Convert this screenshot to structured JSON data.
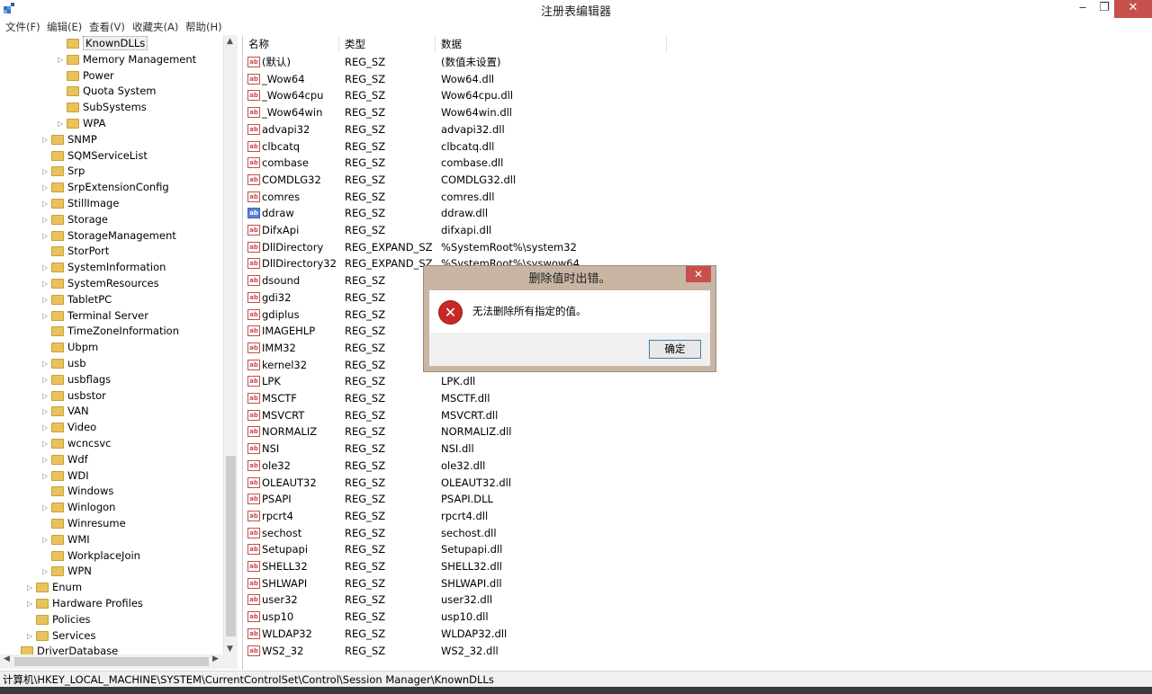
{
  "window": {
    "title": "注册表编辑器",
    "minimize": "‒",
    "restore": "❐",
    "close": "✕"
  },
  "menu": [
    "文件(F)",
    "编辑(E)",
    "查看(V)",
    "收藏夹(A)",
    "帮助(H)"
  ],
  "tree": {
    "items": [
      {
        "label": "KnownDLLs",
        "level": 2,
        "expander": "",
        "selected": true
      },
      {
        "label": "Memory Management",
        "level": 2,
        "expander": "▷"
      },
      {
        "label": "Power",
        "level": 2,
        "expander": ""
      },
      {
        "label": "Quota System",
        "level": 2,
        "expander": ""
      },
      {
        "label": "SubSystems",
        "level": 2,
        "expander": ""
      },
      {
        "label": "WPA",
        "level": 2,
        "expander": "▷"
      },
      {
        "label": "SNMP",
        "level": 1,
        "expander": "▷"
      },
      {
        "label": "SQMServiceList",
        "level": 1,
        "expander": ""
      },
      {
        "label": "Srp",
        "level": 1,
        "expander": "▷"
      },
      {
        "label": "SrpExtensionConfig",
        "level": 1,
        "expander": "▷"
      },
      {
        "label": "StillImage",
        "level": 1,
        "expander": "▷"
      },
      {
        "label": "Storage",
        "level": 1,
        "expander": "▷"
      },
      {
        "label": "StorageManagement",
        "level": 1,
        "expander": "▷"
      },
      {
        "label": "StorPort",
        "level": 1,
        "expander": ""
      },
      {
        "label": "SystemInformation",
        "level": 1,
        "expander": "▷"
      },
      {
        "label": "SystemResources",
        "level": 1,
        "expander": "▷"
      },
      {
        "label": "TabletPC",
        "level": 1,
        "expander": "▷"
      },
      {
        "label": "Terminal Server",
        "level": 1,
        "expander": "▷"
      },
      {
        "label": "TimeZoneInformation",
        "level": 1,
        "expander": ""
      },
      {
        "label": "Ubpm",
        "level": 1,
        "expander": ""
      },
      {
        "label": "usb",
        "level": 1,
        "expander": "▷"
      },
      {
        "label": "usbflags",
        "level": 1,
        "expander": "▷"
      },
      {
        "label": "usbstor",
        "level": 1,
        "expander": "▷"
      },
      {
        "label": "VAN",
        "level": 1,
        "expander": "▷"
      },
      {
        "label": "Video",
        "level": 1,
        "expander": "▷"
      },
      {
        "label": "wcncsvc",
        "level": 1,
        "expander": "▷"
      },
      {
        "label": "Wdf",
        "level": 1,
        "expander": "▷"
      },
      {
        "label": "WDI",
        "level": 1,
        "expander": "▷"
      },
      {
        "label": "Windows",
        "level": 1,
        "expander": ""
      },
      {
        "label": "Winlogon",
        "level": 1,
        "expander": "▷"
      },
      {
        "label": "Winresume",
        "level": 1,
        "expander": ""
      },
      {
        "label": "WMI",
        "level": 1,
        "expander": "▷"
      },
      {
        "label": "WorkplaceJoin",
        "level": 1,
        "expander": ""
      },
      {
        "label": "WPN",
        "level": 1,
        "expander": "▷"
      },
      {
        "label": "Enum",
        "level": 0,
        "expander": "▷"
      },
      {
        "label": "Hardware Profiles",
        "level": 0,
        "expander": "▷"
      },
      {
        "label": "Policies",
        "level": 0,
        "expander": ""
      },
      {
        "label": "Services",
        "level": 0,
        "expander": "▷"
      },
      {
        "label": "DriverDatabase",
        "level": -1,
        "expander": ""
      }
    ]
  },
  "list": {
    "headers": {
      "name": "名称",
      "type": "类型",
      "data": "数据"
    },
    "icon_text": "ab",
    "rows": [
      {
        "name": "(默认)",
        "type": "REG_SZ",
        "data": "(数值未设置)"
      },
      {
        "name": "_Wow64",
        "type": "REG_SZ",
        "data": "Wow64.dll"
      },
      {
        "name": "_Wow64cpu",
        "type": "REG_SZ",
        "data": "Wow64cpu.dll"
      },
      {
        "name": "_Wow64win",
        "type": "REG_SZ",
        "data": "Wow64win.dll"
      },
      {
        "name": "advapi32",
        "type": "REG_SZ",
        "data": "advapi32.dll"
      },
      {
        "name": "clbcatq",
        "type": "REG_SZ",
        "data": "clbcatq.dll"
      },
      {
        "name": "combase",
        "type": "REG_SZ",
        "data": "combase.dll"
      },
      {
        "name": "COMDLG32",
        "type": "REG_SZ",
        "data": "COMDLG32.dll"
      },
      {
        "name": "comres",
        "type": "REG_SZ",
        "data": "comres.dll"
      },
      {
        "name": "ddraw",
        "type": "REG_SZ",
        "data": "ddraw.dll",
        "selected": true
      },
      {
        "name": "DifxApi",
        "type": "REG_SZ",
        "data": "difxapi.dll"
      },
      {
        "name": "DllDirectory",
        "type": "REG_EXPAND_SZ",
        "data": "%SystemRoot%\\system32"
      },
      {
        "name": "DllDirectory32",
        "type": "REG_EXPAND_SZ",
        "data": "%SystemRoot%\\syswow64"
      },
      {
        "name": "dsound",
        "type": "REG_SZ",
        "data": ""
      },
      {
        "name": "gdi32",
        "type": "REG_SZ",
        "data": ""
      },
      {
        "name": "gdiplus",
        "type": "REG_SZ",
        "data": ""
      },
      {
        "name": "IMAGEHLP",
        "type": "REG_SZ",
        "data": ""
      },
      {
        "name": "IMM32",
        "type": "REG_SZ",
        "data": ""
      },
      {
        "name": "kernel32",
        "type": "REG_SZ",
        "data": ""
      },
      {
        "name": "LPK",
        "type": "REG_SZ",
        "data": "LPK.dll"
      },
      {
        "name": "MSCTF",
        "type": "REG_SZ",
        "data": "MSCTF.dll"
      },
      {
        "name": "MSVCRT",
        "type": "REG_SZ",
        "data": "MSVCRT.dll"
      },
      {
        "name": "NORMALIZ",
        "type": "REG_SZ",
        "data": "NORMALIZ.dll"
      },
      {
        "name": "NSI",
        "type": "REG_SZ",
        "data": "NSI.dll"
      },
      {
        "name": "ole32",
        "type": "REG_SZ",
        "data": "ole32.dll"
      },
      {
        "name": "OLEAUT32",
        "type": "REG_SZ",
        "data": "OLEAUT32.dll"
      },
      {
        "name": "PSAPI",
        "type": "REG_SZ",
        "data": "PSAPI.DLL"
      },
      {
        "name": "rpcrt4",
        "type": "REG_SZ",
        "data": "rpcrt4.dll"
      },
      {
        "name": "sechost",
        "type": "REG_SZ",
        "data": "sechost.dll"
      },
      {
        "name": "Setupapi",
        "type": "REG_SZ",
        "data": "Setupapi.dll"
      },
      {
        "name": "SHELL32",
        "type": "REG_SZ",
        "data": "SHELL32.dll"
      },
      {
        "name": "SHLWAPI",
        "type": "REG_SZ",
        "data": "SHLWAPI.dll"
      },
      {
        "name": "user32",
        "type": "REG_SZ",
        "data": "user32.dll"
      },
      {
        "name": "usp10",
        "type": "REG_SZ",
        "data": "usp10.dll"
      },
      {
        "name": "WLDAP32",
        "type": "REG_SZ",
        "data": "WLDAP32.dll"
      },
      {
        "name": "WS2_32",
        "type": "REG_SZ",
        "data": "WS2_32.dll"
      }
    ]
  },
  "status": {
    "path": "计算机\\HKEY_LOCAL_MACHINE\\SYSTEM\\CurrentControlSet\\Control\\Session Manager\\KnownDLLs"
  },
  "dialog": {
    "title": "删除值时出错。",
    "close": "✕",
    "icon": "error-icon",
    "message": "无法删除所有指定的值。",
    "ok_label": "确定"
  },
  "colors": {
    "dialog_frame": "#c8b6a3",
    "close_red": "#c7504c",
    "folder": "#e8c25c"
  }
}
